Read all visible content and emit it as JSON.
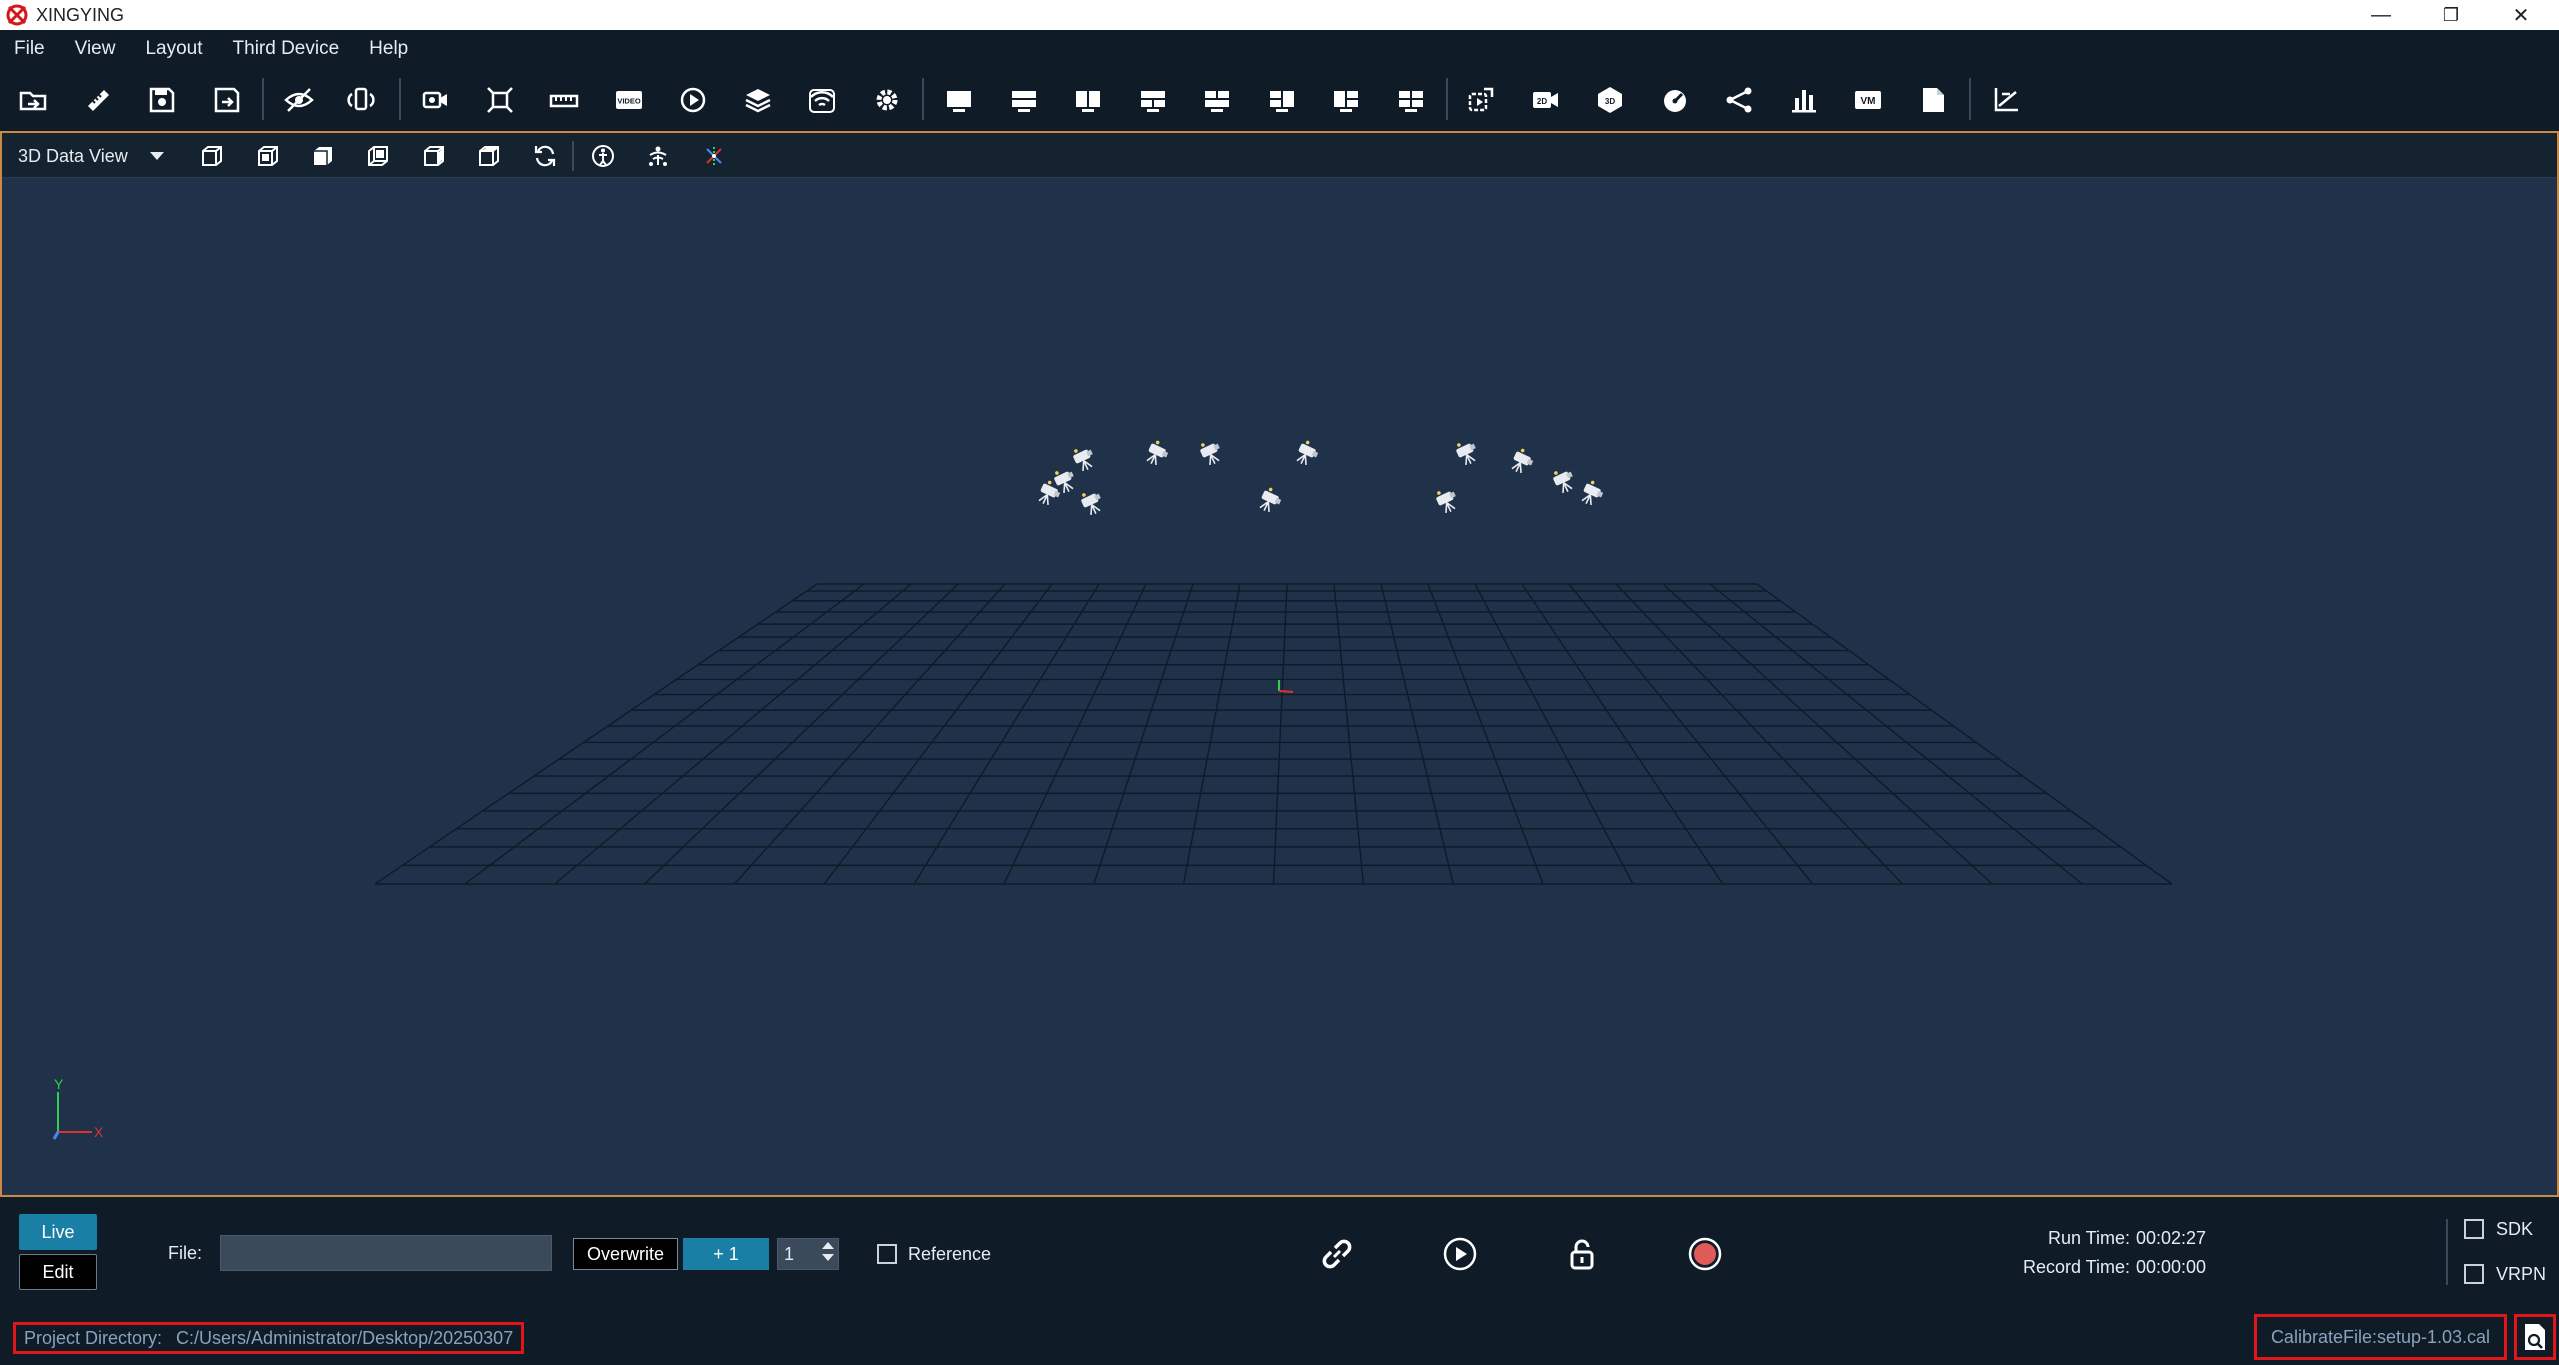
{
  "window": {
    "title": "XINGYING",
    "minimize": "—",
    "maximize": "❐",
    "close": "✕"
  },
  "menu": [
    "File",
    "View",
    "Layout",
    "Third Device",
    "Help"
  ],
  "toolbar": {
    "icons": [
      "open-folder-icon",
      "ruler-icon",
      "save-icon",
      "save-as-icon",
      "hide-icon",
      "camera-sync-icon",
      "video-camera-icon",
      "fit-icon",
      "scale-icon",
      "video-icon",
      "playback-icon",
      "layers-icon",
      "wireless-icon",
      "settings-icon",
      "layout-single-icon",
      "layout-horizontal-icon",
      "layout-vertical-icon",
      "layout-three-top-icon",
      "layout-three-bottom-icon",
      "layout-three-right-icon",
      "layout-three-left-icon",
      "layout-quad-icon",
      "export-icon",
      "2d-view-icon",
      "3d-view-icon",
      "speedometer-icon",
      "skeleton-icon",
      "bar-chart-icon",
      "vm-icon",
      "document-icon",
      "axis-tool-icon"
    ],
    "text_icons": {
      "2d": "2D",
      "3d": "3D",
      "vm": "VM",
      "video": "VIDEO"
    }
  },
  "view": {
    "selected": "3D Data View",
    "subtools": [
      "view-front-icon",
      "view-top-icon",
      "view-side-icon",
      "view-back-icon",
      "view-left-icon",
      "view-perspective-icon",
      "rotate-icon",
      "skeleton-display-icon",
      "marker-display-icon",
      "axis-display-icon"
    ],
    "axis": {
      "x": "X",
      "y": "Y"
    }
  },
  "controls": {
    "live": "Live",
    "edit": "Edit",
    "file_label": "File:",
    "file_value": "",
    "overwrite": "Overwrite",
    "plus_one": "+ 1",
    "counter": "1",
    "reference": "Reference",
    "run_time_label": "Run Time:",
    "run_time": "00:02:27",
    "record_time_label": "Record Time:",
    "record_time": "00:00:00",
    "sdk": "SDK",
    "vrpn": "VRPN"
  },
  "status": {
    "project_label": "Project Directory:",
    "project_path": "C:/Users/Administrator/Desktop/20250307",
    "calibrate_file": "CalibrateFile:setup-1.03.cal"
  },
  "colors": {
    "accent": "#1a7fa4",
    "highlight": "#e0161b",
    "frame": "#c98a45",
    "record": "#e05a5a"
  }
}
